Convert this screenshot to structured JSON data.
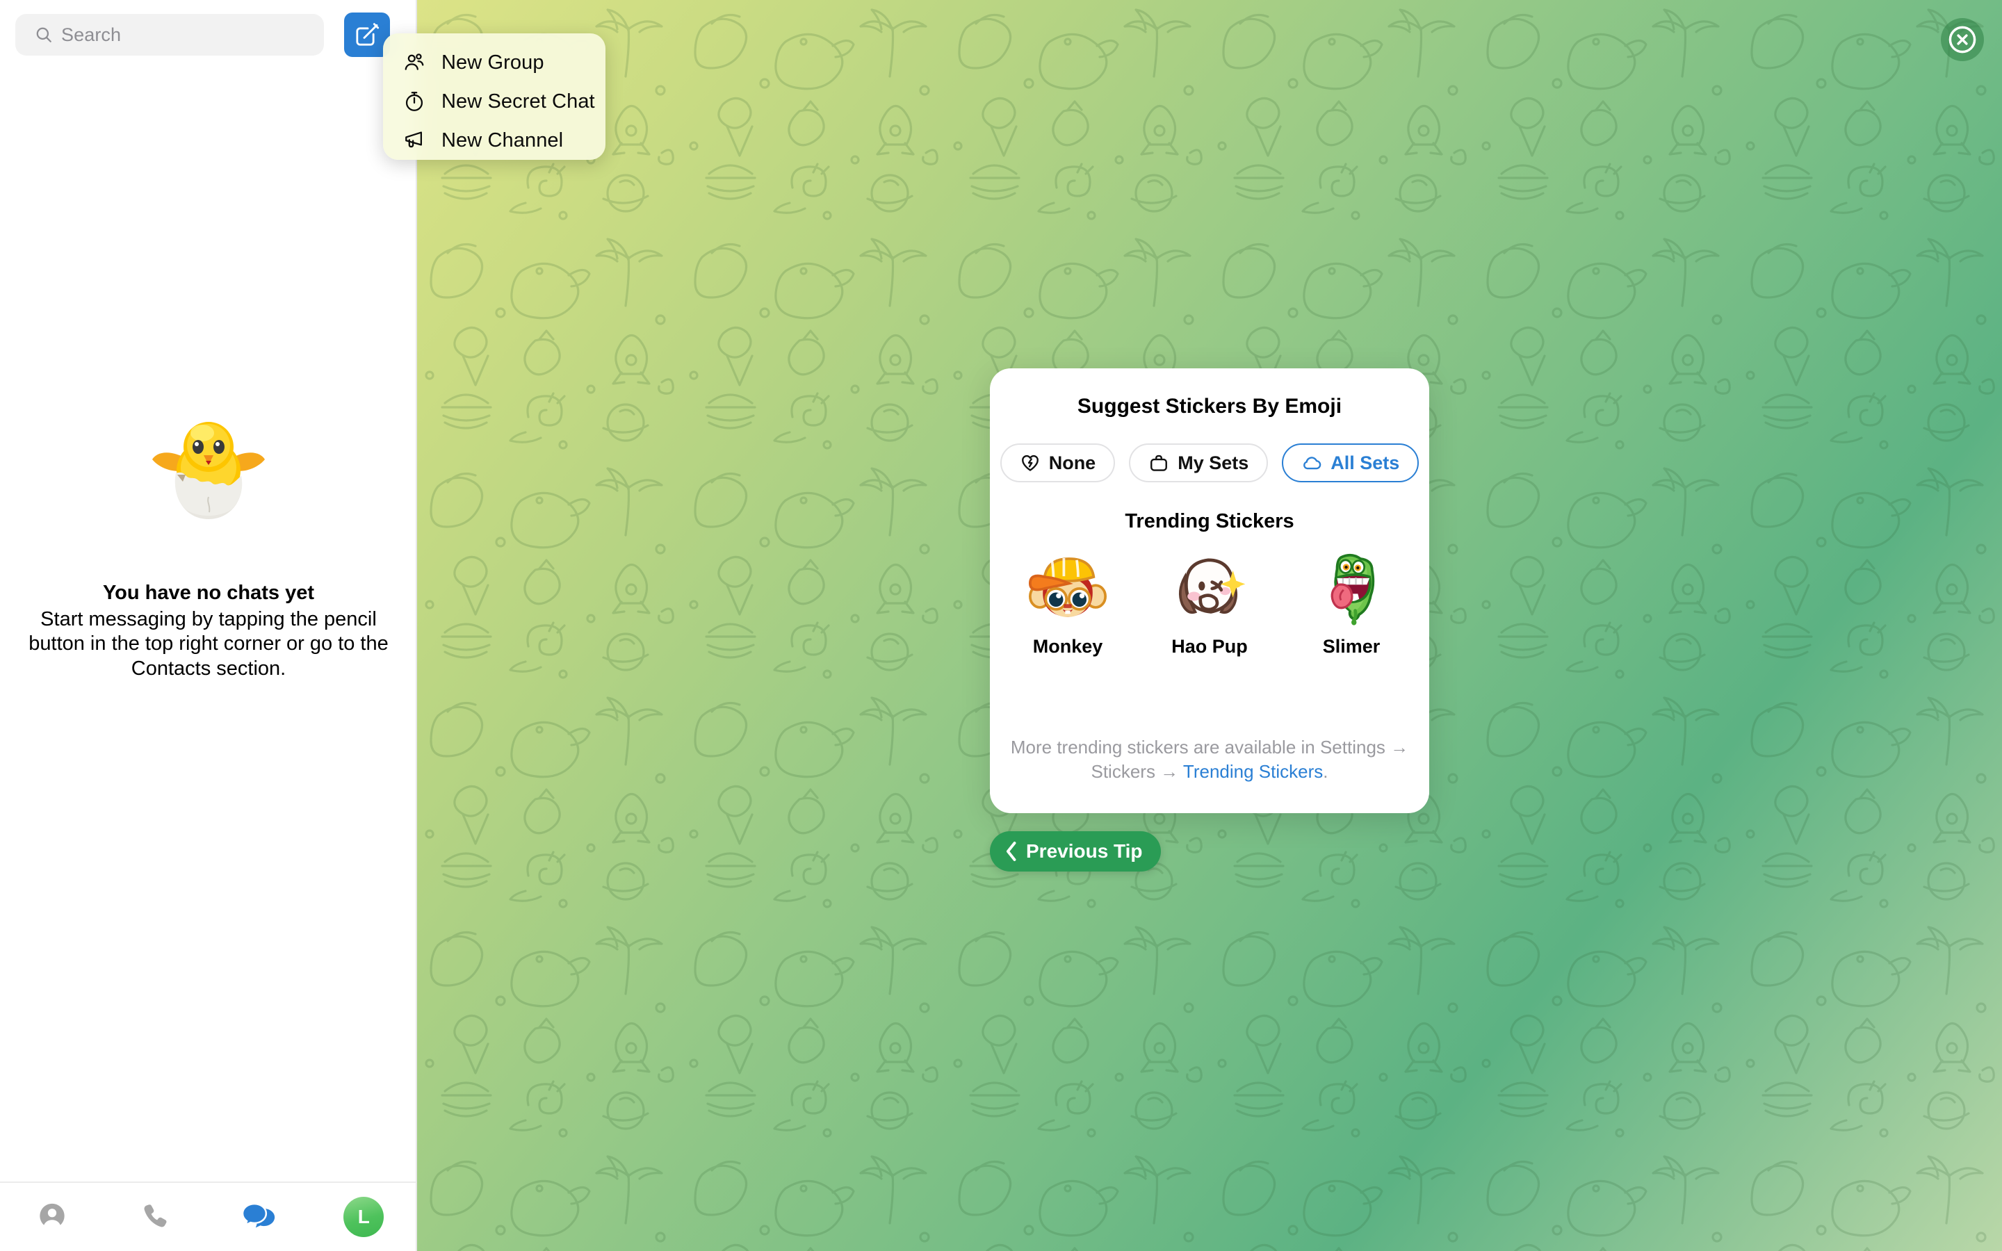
{
  "sidebar": {
    "search": {
      "placeholder": "Search",
      "icon": "search-icon"
    },
    "compose_button": {
      "icon": "compose-pencil-icon",
      "color": "#2a7fd4"
    },
    "empty_state": {
      "illustration": "hatching-chick-icon",
      "title": "You have no chats yet",
      "subtitle": "Start messaging by tapping the pencil button in the top right corner or go to the Contacts section."
    },
    "bottom_nav": [
      {
        "name": "contacts",
        "icon": "person-circle-icon",
        "active": false,
        "color": "#a6a6a6"
      },
      {
        "name": "calls",
        "icon": "phone-icon",
        "active": false,
        "color": "#a6a6a6"
      },
      {
        "name": "chats",
        "icon": "chat-bubbles-icon",
        "active": true,
        "color": "#2a7fd4"
      },
      {
        "name": "settings",
        "icon": "avatar",
        "active": false,
        "avatar_letter": "L",
        "color": "#4ac157"
      }
    ]
  },
  "dropdown": {
    "items": [
      {
        "label": "New Group",
        "icon": "people-icon"
      },
      {
        "label": "New Secret Chat",
        "icon": "stopwatch-icon"
      },
      {
        "label": "New Channel",
        "icon": "megaphone-icon"
      }
    ]
  },
  "tip_card": {
    "title": "Suggest Stickers By Emoji",
    "segments": [
      {
        "label": "None",
        "icon": "broken-heart-icon",
        "selected": false
      },
      {
        "label": "My Sets",
        "icon": "briefcase-icon",
        "selected": false
      },
      {
        "label": "All Sets",
        "icon": "cloud-icon",
        "selected": true
      }
    ],
    "trending_title": "Trending Stickers",
    "stickers": [
      {
        "name": "Monkey",
        "art": "monkey-cap-sticker"
      },
      {
        "name": "Hao Pup",
        "art": "hao-pup-sticker"
      },
      {
        "name": "Slimer",
        "art": "slimer-sticker"
      }
    ],
    "footer_prefix": "More trending stickers are available in Settings → Stickers → ",
    "footer_link": "Trending Stickers",
    "footer_suffix": "."
  },
  "previous_tip_button": {
    "label": "Previous Tip",
    "icon": "chevron-left-icon",
    "color": "#2a9c55"
  },
  "close_button": {
    "icon": "close-circle-icon"
  },
  "colors": {
    "accent_blue": "#2a7fd4",
    "green_button": "#2a9c55",
    "wallpaper_start": "#dce387",
    "wallpaper_end": "#5cb283",
    "menu_bg": "#f7fade"
  }
}
